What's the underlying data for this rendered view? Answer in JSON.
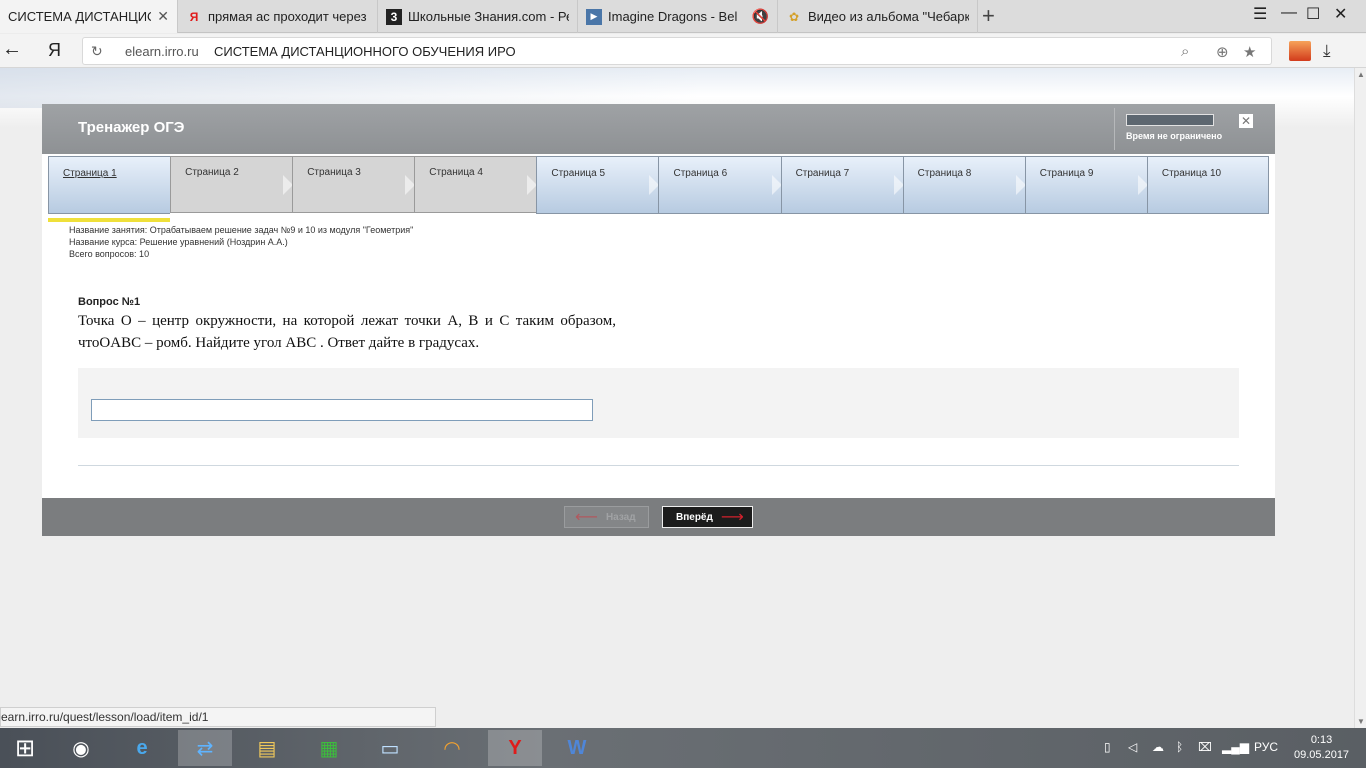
{
  "browser": {
    "tabs": [
      {
        "label": "СИСТЕМА ДИСТАНЦИОННО",
        "icon": "yandex-tab-icon",
        "active": true
      },
      {
        "label": "прямая ас проходит через",
        "icon": "yandex-y-icon"
      },
      {
        "label": "Школьные Знания.com - Ре",
        "icon": "znanija-icon"
      },
      {
        "label": "Imagine Dragons - Bel",
        "icon": "play-icon"
      },
      {
        "label": "Видео из альбома \"Чебарку",
        "icon": "photo-icon"
      }
    ],
    "tab_close": "✕",
    "new_tab": "+",
    "menu_icon": "☰",
    "minimize": "—",
    "maximize": "☐",
    "close": "✕",
    "back": "←",
    "yandex_logo": "Я",
    "reload": "↻",
    "address_domain": "elearn.irro.ru",
    "address_title": "СИСТЕМА ДИСТАНЦИОННОГО ОБУЧЕНИЯ ИРО",
    "search_glyph": "⌕",
    "globe_glyph": "⊕",
    "star_glyph": "★",
    "download_glyph": "⤓"
  },
  "trainer": {
    "title": "Тренажер ОГЭ",
    "timer_text": "Время не ограничено",
    "close_label": "✕",
    "pages": [
      {
        "label": "Страница 1",
        "state": "current"
      },
      {
        "label": "Страница 2",
        "state": "done"
      },
      {
        "label": "Страница 3",
        "state": "done"
      },
      {
        "label": "Страница 4",
        "state": "done"
      },
      {
        "label": "Страница 5",
        "state": "todo"
      },
      {
        "label": "Страница 6",
        "state": "todo"
      },
      {
        "label": "Страница 7",
        "state": "todo"
      },
      {
        "label": "Страница 8",
        "state": "todo"
      },
      {
        "label": "Страница 9",
        "state": "todo"
      },
      {
        "label": "Страница 10",
        "state": "todo"
      }
    ],
    "lesson_name": "Название занятия: Отрабатываем решение задач №9 и 10 из модуля \"Геометрия\"",
    "course_name": "Название курса: Решение уравнений (Ноздрин А.А.)",
    "total_questions": "Всего вопросов: 10",
    "question_number": "Вопрос №1",
    "question_text": "Точка O – центр окружности, на которой лежат точки A, B и C таким образом, чтоOABC – ромб. Найдите угол ABC . Ответ дайте в градусах.",
    "answer_value": "",
    "back_label": "Назад",
    "next_label": "Вперёд",
    "arrow_left": "⟵",
    "arrow_right": "⟶"
  },
  "status_url": "earn.irro.ru/quest/lesson/load/item_id/1",
  "taskbar": {
    "start_glyph": "⊞",
    "apps": [
      "eye-app-icon",
      "ie-icon",
      "teamviewer-icon",
      "explorer-icon",
      "store-icon",
      "lenovo-icon",
      "headphones-icon",
      "yandex-browser-icon",
      "word-icon"
    ],
    "app_glyphs": [
      "◉",
      "e",
      "⇄",
      "▤",
      "▦",
      "▭",
      "◠",
      "Y",
      "W"
    ],
    "language": "РУС",
    "time": "0:13",
    "date": "09.05.2017"
  }
}
